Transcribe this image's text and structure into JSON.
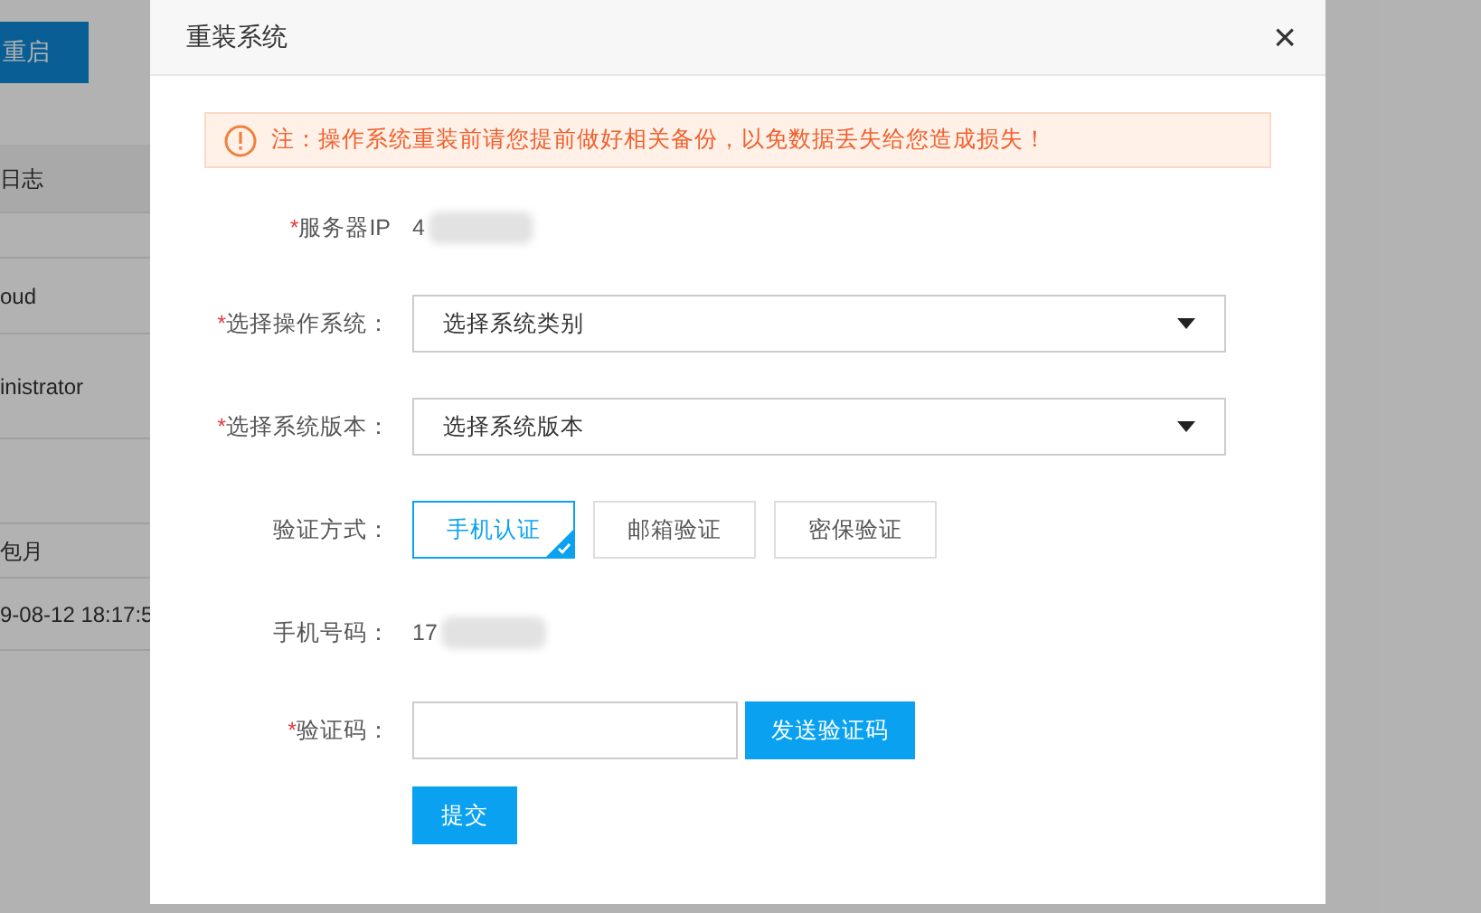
{
  "background": {
    "buttons": [
      "重启"
    ],
    "rows": [
      "日志",
      "",
      "oud",
      "inistrator",
      "",
      "包月",
      "9-08-12 18:17:5"
    ]
  },
  "dialog": {
    "title": "重装系统",
    "close": "×",
    "notice": "注：操作系统重装前请您提前做好相关备份，以免数据丢失给您造成损失！",
    "fields": [
      {
        "kind": "static",
        "asterisk": "*",
        "label": "服务器IP",
        "value": "4"
      },
      {
        "kind": "select",
        "asterisk": "*",
        "label": "选择操作系统：",
        "value": "选择系统类别"
      },
      {
        "kind": "select",
        "asterisk": "*",
        "label": "选择系统版本：",
        "value": "选择系统版本"
      },
      {
        "kind": "methods",
        "label": "验证方式：",
        "options": [
          {
            "label": "手机认证",
            "selected": true
          },
          {
            "label": "邮箱验证",
            "selected": false
          },
          {
            "label": "密保验证",
            "selected": false
          }
        ]
      },
      {
        "kind": "static",
        "label": "手机号码：",
        "value": "17"
      },
      {
        "kind": "code",
        "asterisk": "*",
        "label": "验证码：",
        "button": "发送验证码"
      }
    ],
    "submit": "提交"
  }
}
